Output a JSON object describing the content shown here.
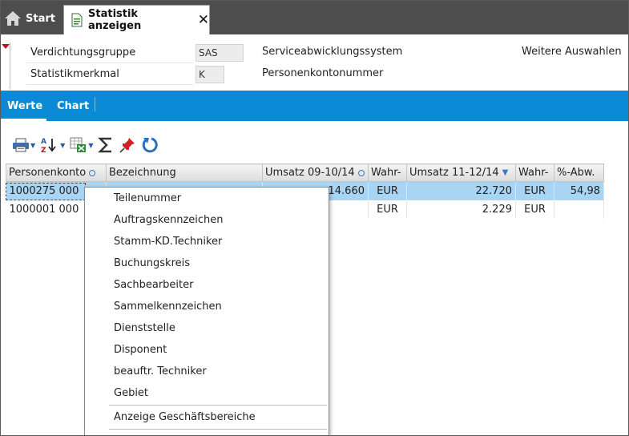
{
  "tabs": {
    "start_label": "Start",
    "active_label": "Statistik anzeigen"
  },
  "header": {
    "rows": [
      {
        "label": "Verdichtungsgruppe",
        "value": "SAS",
        "description": "Serviceabwicklungssystem"
      },
      {
        "label": "Statistikmerkmal",
        "value": "K",
        "description": "Personenkontonummer"
      }
    ],
    "more_label": "Weitere Auswahlen"
  },
  "view_tabs": [
    "Werte",
    "Chart"
  ],
  "grid": {
    "columns": [
      "Personenkonto",
      "Bezeichnung",
      "Umsatz 09-10/14",
      "Wahr-",
      "Umsatz 11-12/14",
      "Wahr-",
      "%-Abw."
    ],
    "rows": [
      [
        "1000275 000",
        "",
        "14.660",
        "EUR",
        "22.720",
        "EUR",
        "54,98"
      ],
      [
        "1000001 000",
        "",
        "",
        "EUR",
        "2.229",
        "EUR",
        ""
      ]
    ]
  },
  "context_menu": {
    "items": [
      "Teilenummer",
      "Auftragskennzeichen",
      "Stamm-KD.Techniker",
      "Buchungskreis",
      "Sachbearbeiter",
      "Sammelkennzeichen",
      "Dienststelle",
      "Disponent",
      "beauftr. Techniker",
      "Gebiet"
    ],
    "footer_item": "Anzeige Geschäftsbereiche"
  },
  "colors": {
    "tabbar": "#4d4d4d",
    "accent_blue": "#0a8ad4",
    "selected_row": "#a9d5f5",
    "marker_red": "#c0121b"
  },
  "icons": [
    "home-icon",
    "document-icon",
    "close-icon",
    "print-icon",
    "sort-az-icon",
    "excel-export-icon",
    "sum-icon",
    "pin-icon",
    "refresh-icon"
  ]
}
